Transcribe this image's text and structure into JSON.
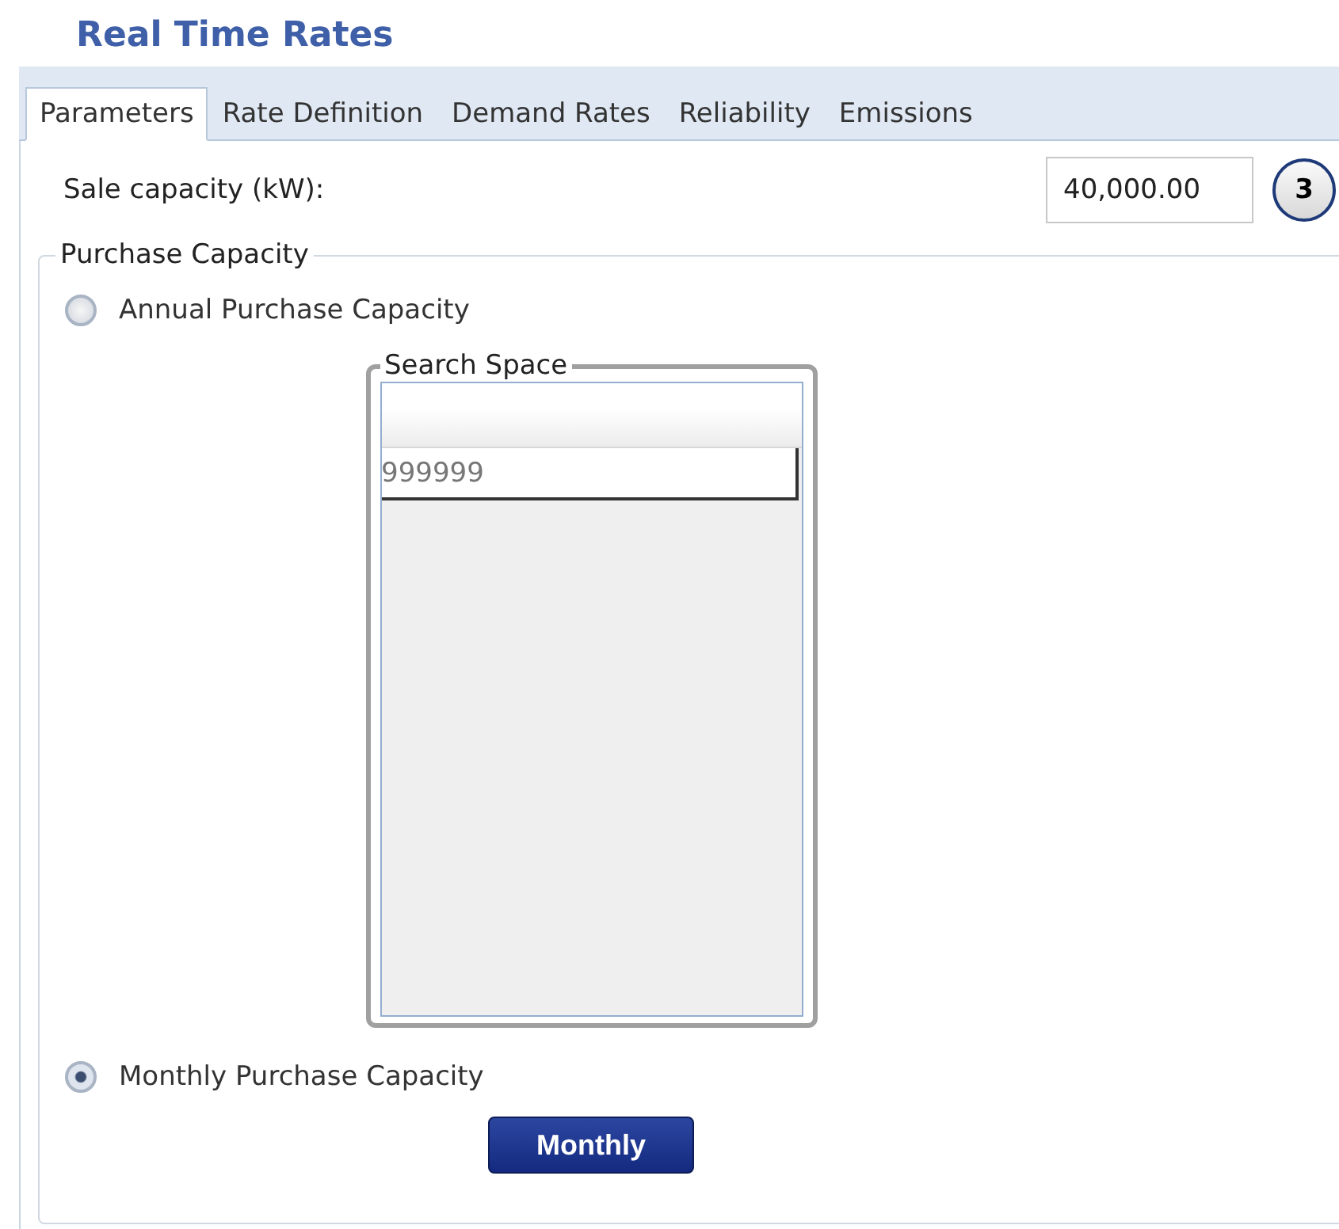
{
  "title": "Real Time Rates",
  "tabs": [
    {
      "label": "Parameters",
      "selected": true
    },
    {
      "label": "Rate Definition",
      "selected": false
    },
    {
      "label": "Demand Rates",
      "selected": false
    },
    {
      "label": "Reliability",
      "selected": false
    },
    {
      "label": "Emissions",
      "selected": false
    }
  ],
  "sale_capacity": {
    "label": "Sale capacity (kW):",
    "value": "40,000.00",
    "badge": "3"
  },
  "purchase_capacity": {
    "legend": "Purchase Capacity",
    "options": [
      {
        "label": "Annual Purchase Capacity",
        "selected": false
      },
      {
        "label": "Monthly Purchase Capacity",
        "selected": true
      }
    ],
    "search_space": {
      "legend": "Search Space",
      "rows": [
        "999999"
      ]
    },
    "button": "Monthly"
  }
}
